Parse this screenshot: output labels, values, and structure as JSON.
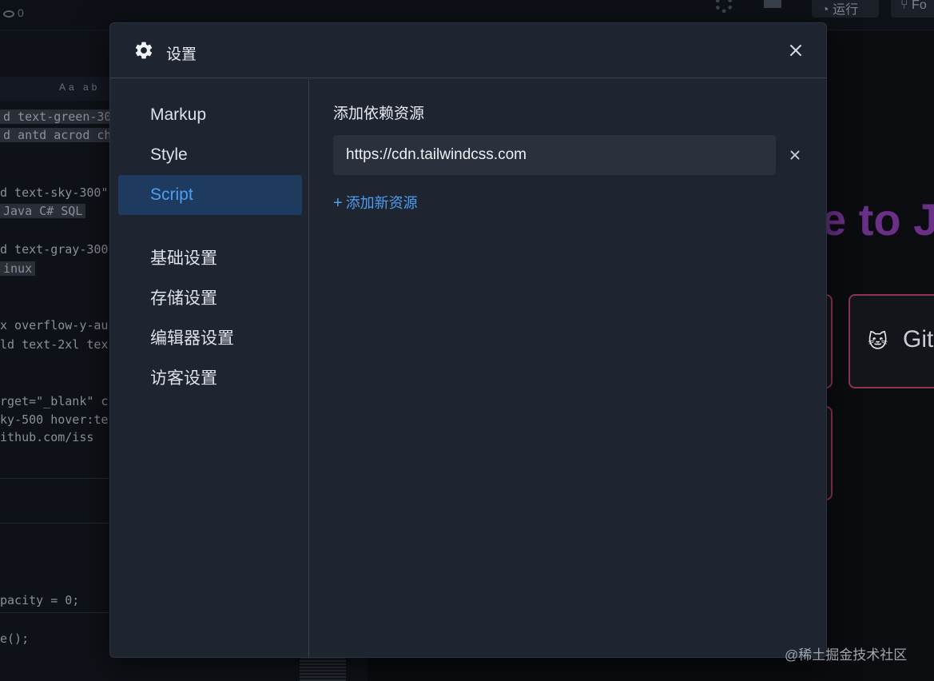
{
  "background": {
    "view_count": "0",
    "run_label": "运行",
    "fork_label": "Fo",
    "find_icons": "Aa ab",
    "code_lines": [
      {
        "text": "d text-green-30",
        "highlight": true
      },
      {
        "text": "d antd acrod ch",
        "highlight": true
      },
      {
        "text": "d text-sky-300\"",
        "highlight": false
      },
      {
        "text": " Java C# SQL ",
        "highlight": true
      },
      {
        "text": "d text-gray-300",
        "highlight": false
      },
      {
        "text": "inux ",
        "highlight": true
      },
      {
        "text": "x overflow-y-au",
        "highlight": false
      },
      {
        "text": "ld text-2xl tex",
        "highlight": false
      },
      {
        "text": "rget=\"_blank\" c",
        "highlight": false
      },
      {
        "text": "ky-500 hover:te",
        "highlight": false
      },
      {
        "text": "ithub.com/iss",
        "highlight": false
      },
      {
        "text": "pacity = 0;",
        "highlight": false
      },
      {
        "text": "e();",
        "highlight": false
      }
    ],
    "hero_text": "e to J",
    "card_label": "Git",
    "card_emoji": "🐱"
  },
  "modal": {
    "title": "设置",
    "nav_items": [
      {
        "label": "Markup",
        "active": false
      },
      {
        "label": "Style",
        "active": false
      },
      {
        "label": "Script",
        "active": true
      },
      {
        "label": "基础设置",
        "active": false
      },
      {
        "label": "存储设置",
        "active": false
      },
      {
        "label": "编辑器设置",
        "active": false
      },
      {
        "label": "访客设置",
        "active": false
      }
    ],
    "section_title": "添加依赖资源",
    "resource_value": "https://cdn.tailwindcss.com",
    "add_resource_label": "添加新资源"
  },
  "watermark": "@稀土掘金技术社区",
  "colors": {
    "accent": "#4d9ff5",
    "active_bg": "#1e3a5f",
    "modal_bg": "#1e2430"
  }
}
